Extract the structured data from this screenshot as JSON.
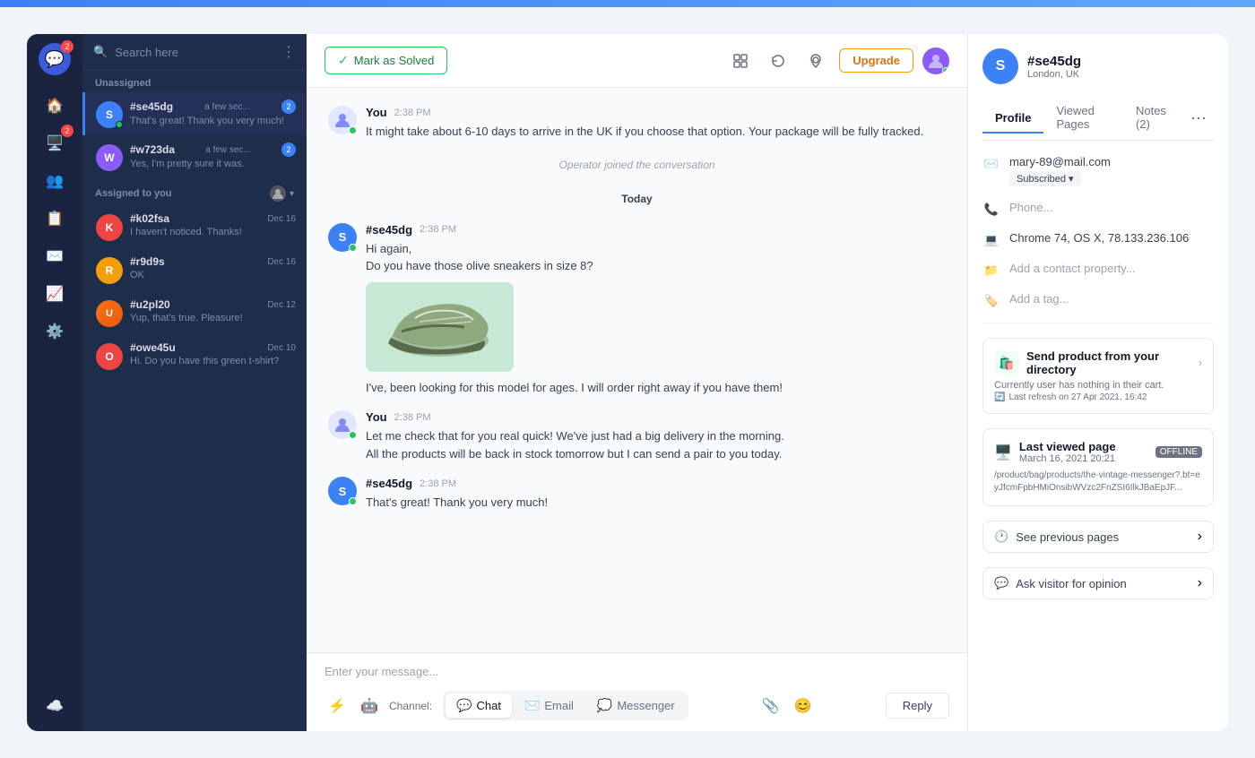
{
  "topbar": {
    "gradient": "blue"
  },
  "sidebar": {
    "logo_badge": "2",
    "nav_items": [
      {
        "icon": "🏠",
        "name": "home",
        "active": false
      },
      {
        "icon": "💬",
        "name": "chat",
        "active": false,
        "badge": "2"
      },
      {
        "icon": "👥",
        "name": "contacts",
        "active": false
      },
      {
        "icon": "📋",
        "name": "reports",
        "active": false
      },
      {
        "icon": "📧",
        "name": "email",
        "active": false
      },
      {
        "icon": "📈",
        "name": "analytics",
        "active": false
      },
      {
        "icon": "⚙️",
        "name": "settings",
        "active": false
      }
    ],
    "bottom_icon": "☁️"
  },
  "conv_panel": {
    "search_placeholder": "Search here",
    "sections": [
      {
        "label": "Unassigned",
        "items": [
          {
            "id": "#se45dg",
            "avatar_letter": "S",
            "avatar_color": "#3b82f6",
            "time": "a few sec...",
            "badge": "2",
            "preview": "That's great! Thank you very much!",
            "online": true
          },
          {
            "id": "#w723da",
            "avatar_letter": "W",
            "avatar_color": "#8b5cf6",
            "time": "a few sec...",
            "badge": "2",
            "preview": "Yes, I'm pretty sure it was.",
            "online": false
          }
        ]
      },
      {
        "label": "Assigned to you",
        "items": [
          {
            "id": "#k02fsa",
            "avatar_letter": "K",
            "avatar_color": "#ef4444",
            "time": "Dec 16",
            "badge": null,
            "preview": "I haven't noticed. Thanks!",
            "online": false
          },
          {
            "id": "#r9d9s",
            "avatar_letter": "R",
            "avatar_color": "#f59e0b",
            "time": "Dec 16",
            "badge": null,
            "preview": "OK",
            "online": false
          },
          {
            "id": "#u2pl20",
            "avatar_letter": "U",
            "avatar_color": "#e07b4a",
            "time": "Dec 12",
            "badge": null,
            "preview": "Yup, that's true. Pleasure!",
            "online": false,
            "has_img": true
          },
          {
            "id": "#owe45u",
            "avatar_letter": "O",
            "avatar_color": "#ef4444",
            "time": "Dec 10",
            "badge": null,
            "preview": "Hi. Do you have this green t-shirt?",
            "online": false
          }
        ]
      }
    ]
  },
  "chat": {
    "mark_solved_label": "Mark as Solved",
    "upgrade_label": "Upgrade",
    "system_message": "Operator joined the conversation",
    "today_label": "Today",
    "messages": [
      {
        "sender": "You",
        "time": "2:38 PM",
        "type": "agent",
        "text": "It might take about 6-10 days to arrive in the UK if you choose that option. Your package will be fully tracked."
      },
      {
        "sender": "#se45dg",
        "time": "2:38 PM",
        "type": "visitor",
        "text": "Hi again,\nDo you have those olive sneakers in size 8?",
        "has_image": true
      },
      {
        "sender": "You",
        "time": "2:38 PM",
        "type": "agent",
        "text": "Let me check that for you real quick! We've just had a big delivery in the morning.\nAll the products will be back in stock tomorrow but I can send a pair to you today."
      },
      {
        "sender": "#se45dg",
        "time": "2:38 PM",
        "type": "visitor",
        "text": "That's great! Thank you very much!"
      }
    ],
    "visitor_additional_text": "I've, been looking for this model for ages. I will order right away if you have them!",
    "input_placeholder": "Enter your message...",
    "channel_label": "Channel:",
    "channels": [
      {
        "name": "Chat",
        "icon": "💬",
        "active": true
      },
      {
        "name": "Email",
        "icon": "✉️",
        "active": false
      },
      {
        "name": "Messenger",
        "icon": "💭",
        "active": false
      }
    ],
    "reply_label": "Reply"
  },
  "right_panel": {
    "contact_name": "#se45dg",
    "contact_location": "London, UK",
    "tabs": [
      {
        "label": "Profile",
        "active": true
      },
      {
        "label": "Viewed Pages",
        "active": false
      },
      {
        "label": "Notes (2)",
        "active": false
      }
    ],
    "email": "mary-89@mail.com",
    "subscribed_label": "Subscribed",
    "phone_placeholder": "Phone...",
    "browser": "Chrome 74, OS X,",
    "ip": "78.133.236.106",
    "add_property_placeholder": "Add a contact property...",
    "add_tag_placeholder": "Add a tag...",
    "product_card": {
      "icon": "🛍️",
      "title": "Send product from your directory",
      "cart_text": "Currently user has nothing in their cart.",
      "refresh_text": "Last refresh on 27 Apr 2021, 16:42"
    },
    "last_viewed": {
      "title": "Last viewed page",
      "date": "March 16, 2021 20:21",
      "status": "OFFLINE",
      "url": "/product/bag/products/the-vintage-messenger?.bt=eyJfcmFpbHMiOnsibWVzc2FnZSI6IlkJBaEpJF..."
    },
    "see_pages_label": "See previous pages",
    "ask_opinion_label": "Ask visitor for opinion"
  }
}
